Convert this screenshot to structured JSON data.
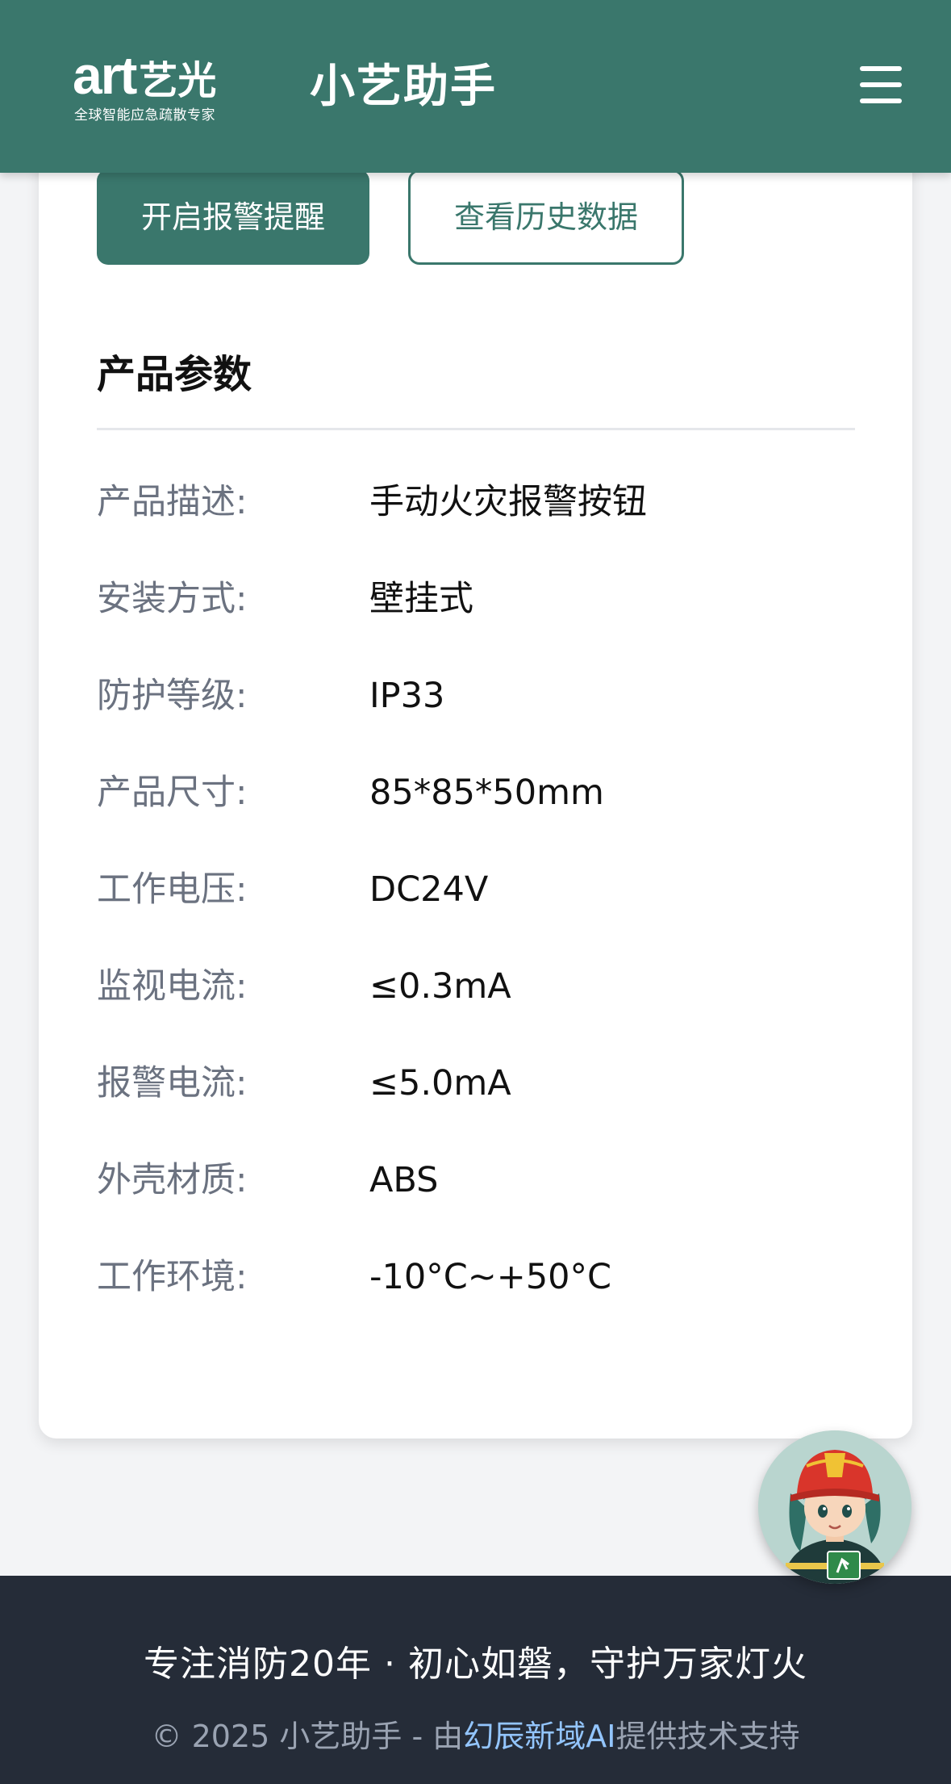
{
  "header": {
    "logo_brand": "art",
    "logo_brand_cn": "艺光",
    "logo_tagline": "全球智能应急疏散专家",
    "app_title": "小艺助手",
    "menu_icon": "hamburger-menu-icon"
  },
  "actions": {
    "primary_label": "开启报警提醒",
    "secondary_label": "查看历史数据"
  },
  "section": {
    "title": "产品参数"
  },
  "params": [
    {
      "label": "产品描述:",
      "value": "手动火灾报警按钮"
    },
    {
      "label": "安装方式:",
      "value": "壁挂式"
    },
    {
      "label": "防护等级:",
      "value": "IP33"
    },
    {
      "label": "产品尺寸:",
      "value": "85*85*50mm"
    },
    {
      "label": "工作电压:",
      "value": "DC24V"
    },
    {
      "label": "监视电流:",
      "value": "≤0.3mA"
    },
    {
      "label": "报警电流:",
      "value": "≤5.0mA"
    },
    {
      "label": "外壳材质:",
      "value": "ABS"
    },
    {
      "label": "工作环境:",
      "value": "-10°C~+50°C"
    }
  ],
  "footer": {
    "slogan": "专注消防20年 · 初心如磐，守护万家灯火",
    "copyright_prefix": "© 2025 小艺助手 - 由",
    "copyright_link": "幻辰新域AI",
    "copyright_suffix": "提供技术支持"
  },
  "colors": {
    "brand": "#3a776c",
    "footer_bg": "#252c38",
    "link": "#93c5fd"
  }
}
